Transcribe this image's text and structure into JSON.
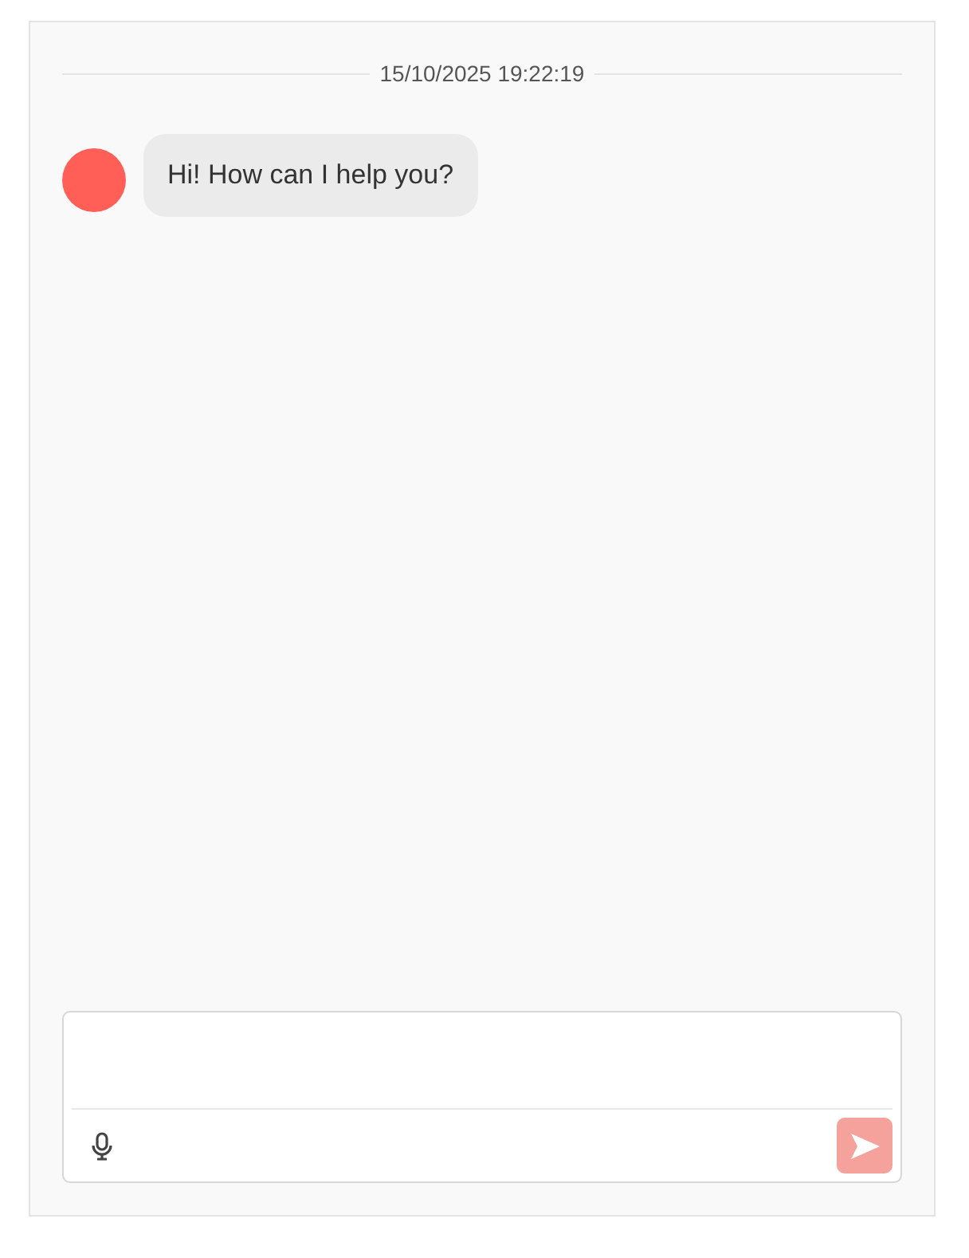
{
  "timestamp": "15/10/2025 19:22:19",
  "messages": [
    {
      "kind": "incoming",
      "text": "Hi! How can I help you?"
    }
  ],
  "composer": {
    "send_disabled": true
  }
}
